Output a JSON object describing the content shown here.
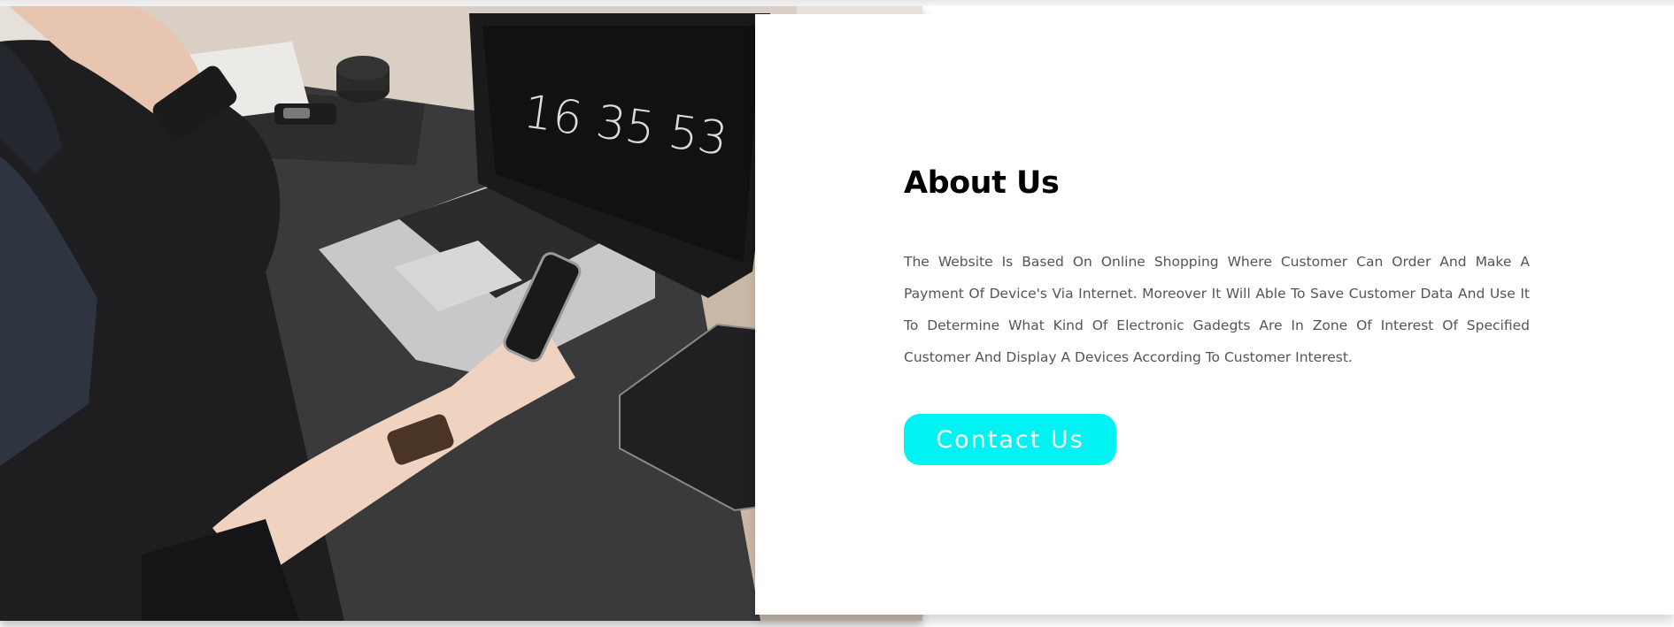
{
  "about": {
    "title": "About Us",
    "description": "The Website Is Based On Online Shopping Where Customer Can Order And Make A Payment Of Device's Via Internet. Moreover It Will Able To Save Customer Data And Use It To Determine What Kind Of Electronic Gadegts Are In Zone Of Interest Of Specified Customer And Display A Devices According To Customer Interest.",
    "contact_label": "Contact Us"
  },
  "photo": {
    "clock_text": "16 35 53"
  },
  "colors": {
    "accent": "#00f3f3",
    "heading": "#000000",
    "body_text": "#555555"
  }
}
